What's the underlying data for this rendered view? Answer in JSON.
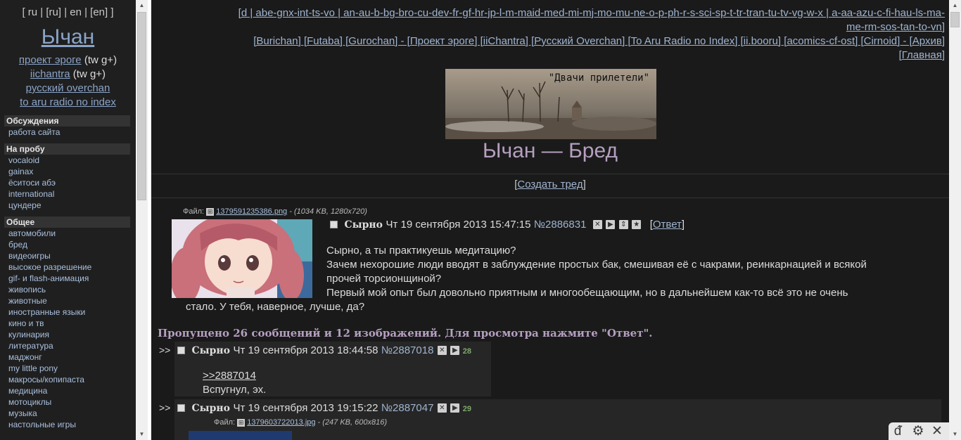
{
  "nav": {
    "langs_text": "[ ru | [ru] | en | [en] ]",
    "site_name": "Ычан",
    "projects": [
      {
        "label": "проект эроге",
        "extra": " (tw g+)"
      },
      {
        "label": "iichantra",
        "extra": " (tw g+)"
      },
      {
        "label": "русский overchan",
        "extra": ""
      },
      {
        "label": "to aru radio no index",
        "extra": ""
      }
    ],
    "sections": [
      {
        "title": "Обсуждения",
        "items": [
          "работа сайта"
        ]
      },
      {
        "title": "На пробу",
        "items": [
          "vocaloid",
          "gainax",
          "ёситоси абэ",
          "international",
          "цундере"
        ]
      },
      {
        "title": "Общее",
        "items": [
          "автомобили",
          "бред",
          "видеоигры",
          "высокое разрешение",
          "gif- и flash-анимация",
          "живопись",
          "животные",
          "иностранные языки",
          "кино и тв",
          "кулинария",
          "литература",
          "маджонг",
          "my little pony",
          "макросы/копипаста",
          "медицина",
          "мотоциклы",
          "музыка",
          "настольные игры"
        ]
      }
    ]
  },
  "boards": {
    "line1": "[d | abe-gnx-int-ts-vo | an-au-b-bg-bro-cu-dev-fr-gf-hr-jp-l-m-maid-med-mi-mj-mo-mu-ne-o-p-ph-r-s-sci-sp-t-tr-tran-tu-tv-vg-w-x | a-aa-azu-c-fi-hau-ls-ma-",
    "line2": "me-rm-sos-tan-to-vn]",
    "line3": "[Burichan] [Futaba] [Gurochan] - [Проект эроге] [iiChantra] [Русский Overchan] [To Aru Radio no Index] [ii.booru] [acomics-cf-ost] [Cirnoid] - [Архив]",
    "line4": "[Главная]"
  },
  "banner_caption": "\"Двачи прилетели\"",
  "board_title": "Ычан — Бред",
  "create_thread": "Создать тред",
  "op": {
    "file_label": "Файл:",
    "file_name": "1379591235386.png",
    "file_meta": " - (1034 KB, 1280x720)",
    "name": "Сырно",
    "date": "Чт 19 сентября 2013 15:47:15",
    "num": "№2886831",
    "reply_label": "Ответ",
    "lines": [
      "Сырно, а ты практикуешь медитацию?",
      "Зачем нехорошие люди вводят в заблуждение простых бак, смешивая её с чакрами, реинкарнацией и всякой",
      "прочей торсионщиной?",
      "Первый мой опыт был довольно приятным и многообещающим, но в дальнейшем как-то всё это не очень",
      "стало. У тебя, наверное, лучше, да?"
    ]
  },
  "omitted": "Пропущено 26 сообщений и 12 изображений. Для просмотра нажмите \"Ответ\".",
  "replies": [
    {
      "arrows": ">>",
      "name": "Сырно",
      "date": "Чт 19 сентября 2013 18:44:58",
      "num": "№2887018",
      "count": "28",
      "quote": ">>2887014",
      "text": "Вспугнул, эх."
    },
    {
      "arrows": ">>",
      "name": "Сырно",
      "date": "Чт 19 сентября 2013 19:15:22",
      "num": "№2887047",
      "count": "29",
      "file_label": "Файл:",
      "file_name": "1379603722013.jpg",
      "file_meta": " - (247 KB, 600x816)"
    }
  ],
  "toolbar_icons": [
    "de-logo-icon",
    "gear-icon",
    "close-icon",
    "star-icon",
    "refresh-icon",
    "arrow-left-icon",
    "arrow-right-icon",
    "arrow-up-icon",
    "arrow-down-icon",
    "zoom-icon",
    "stripes-icon"
  ]
}
